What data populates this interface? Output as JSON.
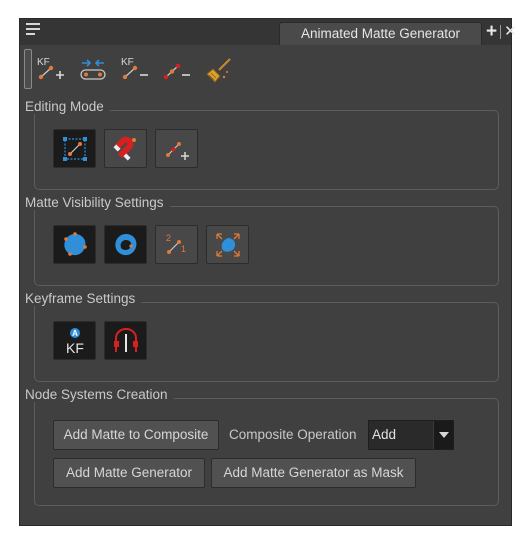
{
  "panel": {
    "tab_title": "Animated Matte Generator"
  },
  "toolbar": {
    "items": [
      {
        "name": "create-keyframe",
        "text": "KF"
      },
      {
        "name": "set-starting-keyframe",
        "text": ""
      },
      {
        "name": "delete-keyframe",
        "text": "KF"
      },
      {
        "name": "remove-point",
        "text": ""
      },
      {
        "name": "broom",
        "text": ""
      }
    ]
  },
  "groups": {
    "editing_mode": {
      "label": "Editing Mode",
      "buttons": [
        "transform",
        "magnet",
        "add-point"
      ]
    },
    "matte_visibility": {
      "label": "Matte Visibility Settings",
      "buttons": [
        "show-outer",
        "show-inner",
        "show-point-order",
        "show-expand"
      ]
    },
    "keyframe_settings": {
      "label": "Keyframe Settings",
      "buttons": [
        "auto-keyframe",
        "onion-skin"
      ],
      "kf_text": "KF",
      "kf_badge": "A"
    },
    "node_systems": {
      "label": "Node Systems Creation",
      "add_to_composite": "Add Matte to Composite",
      "composite_operation_label": "Composite Operation",
      "composite_operation_value": "Add",
      "add_generator": "Add Matte Generator",
      "add_generator_mask": "Add Matte Generator as Mask"
    }
  },
  "colors": {
    "panel_bg": "#404040",
    "accent_orange": "#e07a3a",
    "accent_blue": "#2f8fd8",
    "accent_red": "#d92020"
  }
}
